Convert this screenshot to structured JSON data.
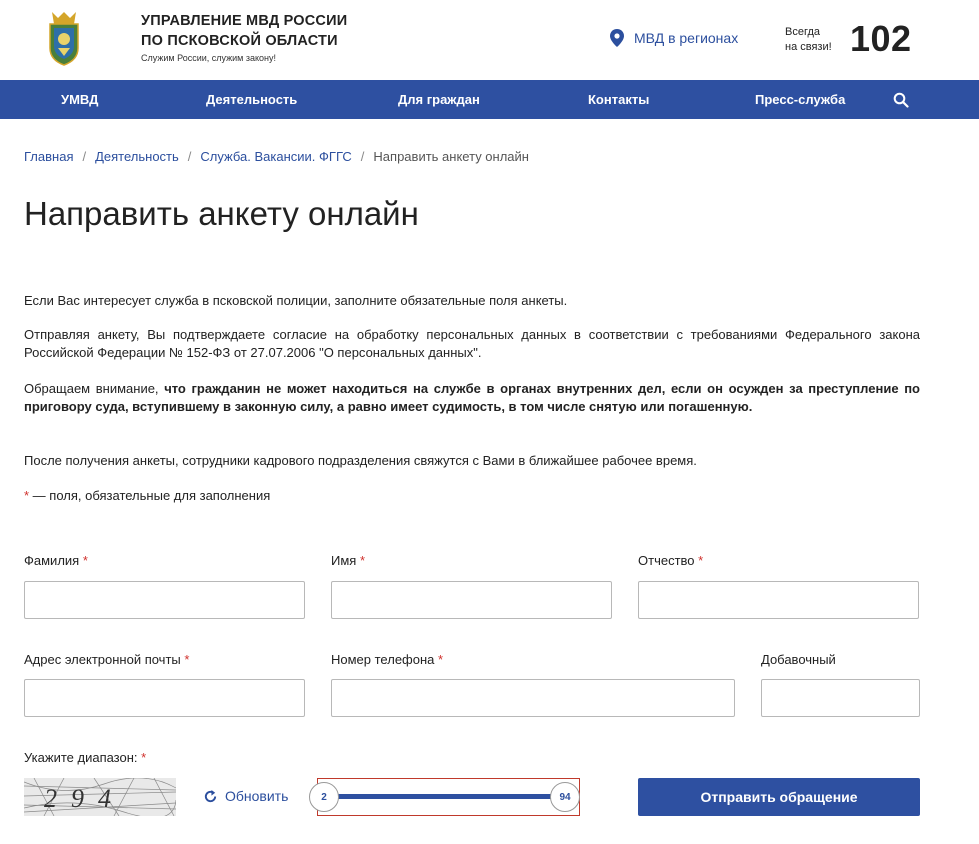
{
  "header": {
    "org_title_line1": "УПРАВЛЕНИЕ МВД РОССИИ",
    "org_title_line2": "ПО ПСКОВСКОЙ ОБЛАСТИ",
    "slogan": "Служим России, служим закону!",
    "regions_link": "МВД в регионах",
    "always_line1": "Всегда",
    "always_line2": "на связи!",
    "hotline": "102"
  },
  "nav": {
    "items": [
      "УМВД",
      "Деятельность",
      "Для граждан",
      "Контакты",
      "Пресс-служба"
    ]
  },
  "breadcrumb": {
    "items": [
      "Главная",
      "Деятельность",
      "Служба. Вакансии. ФГГС"
    ],
    "current": "Направить анкету онлайн",
    "separator": "/"
  },
  "page": {
    "title": "Направить анкету онлайн",
    "intro": "Если Вас интересует служба в псковской полиции, заполните обязательные поля анкеты.",
    "consent": "Отправляя анкету, Вы подтверждаете согласие на обработку персональных данных в соответствии с требованиями Федерального закона Российской Федерации № 152-ФЗ от 27.07.2006 \"О персональных данных\".",
    "notice_prefix": "Обращаем внимание, ",
    "notice_bold": "что гражданин не может находиться на службе в органах внутренних дел, если он осужден за преступление по приговору суда, вступившему в законную силу, а равно имеет судимость, в том числе снятую или погашенную.",
    "after": "После получения анкеты, сотрудники кадрового подразделения свяжутся с Вами в ближайшее рабочее время.",
    "required_star": "*",
    "required_note": " — поля, обязательные для заполнения"
  },
  "form": {
    "surname_label": "Фамилия",
    "name_label": "Имя",
    "patronymic_label": "Отчество",
    "email_label": "Адрес электронной почты",
    "phone_label": "Номер телефона",
    "ext_label": "Добавочный",
    "range_label": "Укажите диапазон:",
    "star": "*",
    "surname_value": "",
    "name_value": "",
    "patronymic_value": "",
    "email_value": "",
    "phone_value": "",
    "ext_value": "",
    "captcha_text": "294",
    "refresh_label": "Обновить",
    "slider_min": "2",
    "slider_max": "94",
    "submit_label": "Отправить обращение"
  },
  "colors": {
    "brand_blue": "#2e50a1",
    "link_blue": "#2c4f9e",
    "required_red": "#d0312d"
  }
}
